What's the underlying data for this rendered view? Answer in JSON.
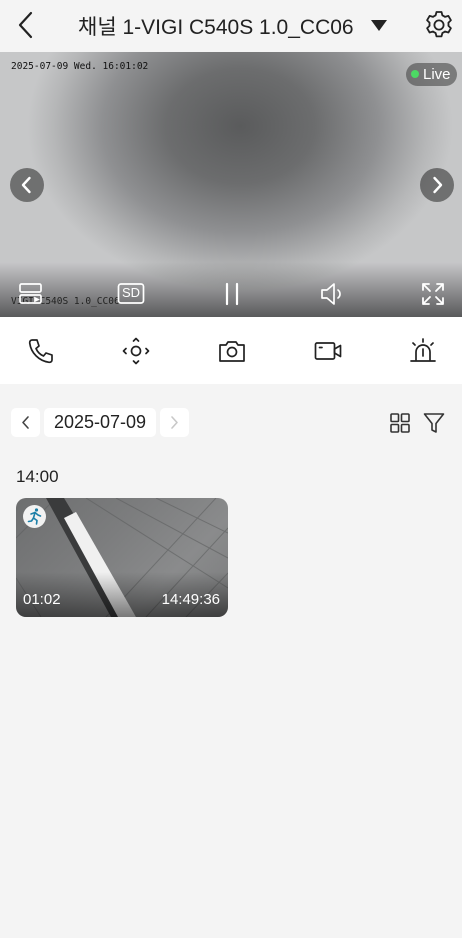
{
  "header": {
    "title": "채널 1-VIGI C540S 1.0_CC06",
    "icons": {
      "back": "chevron-left-icon",
      "dropdown": "caret-down-icon",
      "settings": "gear-icon"
    }
  },
  "video": {
    "osd_timestamp": "2025-07-09 Wed. 16:01:02",
    "osd_camera_name": "VIGI C540S 1.0_CC06",
    "live_label": "Live",
    "colors": {
      "live_dot": "#4cd964"
    },
    "controls": {
      "storage_icon": "storage-icon",
      "sd_label": "SD",
      "pause_icon": "pause-icon",
      "audio_icon": "speaker-icon",
      "fullscreen_icon": "fullscreen-icon"
    }
  },
  "actions": [
    "phone-icon",
    "ptz-icon",
    "camera-icon",
    "video-record-icon",
    "alarm-icon"
  ],
  "playback": {
    "date": "2025-07-09",
    "hour_label": "14:00",
    "clips": [
      {
        "duration": "01:02",
        "time": "14:49:36",
        "type_icon": "motion-detection-icon"
      }
    ]
  }
}
